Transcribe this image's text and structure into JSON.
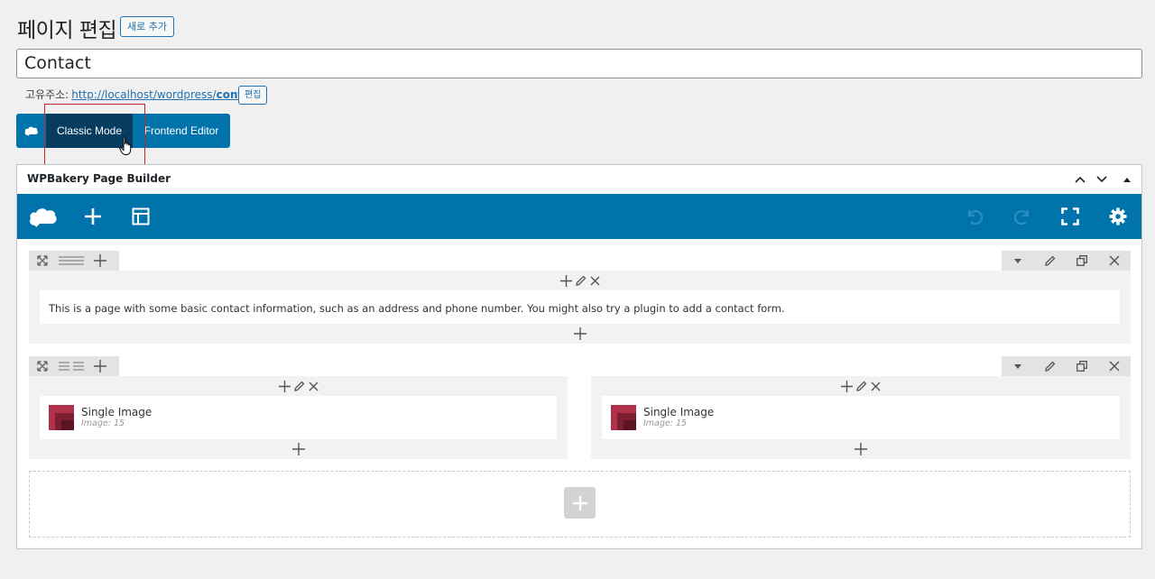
{
  "header": {
    "title": "페이지 편집",
    "add_new_label": "새로 추가"
  },
  "post": {
    "title_value": "Contact"
  },
  "permalink": {
    "label": "고유주소:",
    "url_prefix": "http://localhost/wordpress/",
    "slug": "contact",
    "url_suffix": "/",
    "edit_label": "편집"
  },
  "modes": {
    "classic_label": "Classic Mode",
    "frontend_label": "Frontend Editor"
  },
  "builder": {
    "title": "WPBakery Page Builder",
    "icons": {
      "logo": "wpbakery-cloud-icon",
      "add": "plus-icon",
      "templates": "layout-template-icon",
      "undo": "undo-icon",
      "redo": "redo-icon",
      "fullscreen": "fullscreen-icon",
      "settings": "gear-icon"
    }
  },
  "rows": [
    {
      "columns": [
        {
          "elements": [
            {
              "type": "text",
              "text": "This is a page with some basic contact information, such as an address and phone number. You might also try a plugin to add a contact form."
            }
          ]
        }
      ]
    },
    {
      "columns": [
        {
          "elements": [
            {
              "type": "image",
              "name": "Single Image",
              "sub": "Image: 15"
            }
          ]
        },
        {
          "elements": [
            {
              "type": "image",
              "name": "Single Image",
              "sub": "Image: 15"
            }
          ]
        }
      ]
    }
  ],
  "colors": {
    "accent": "#0073aa",
    "classic_active": "#063d5f",
    "highlight_box": "#c0282d"
  }
}
